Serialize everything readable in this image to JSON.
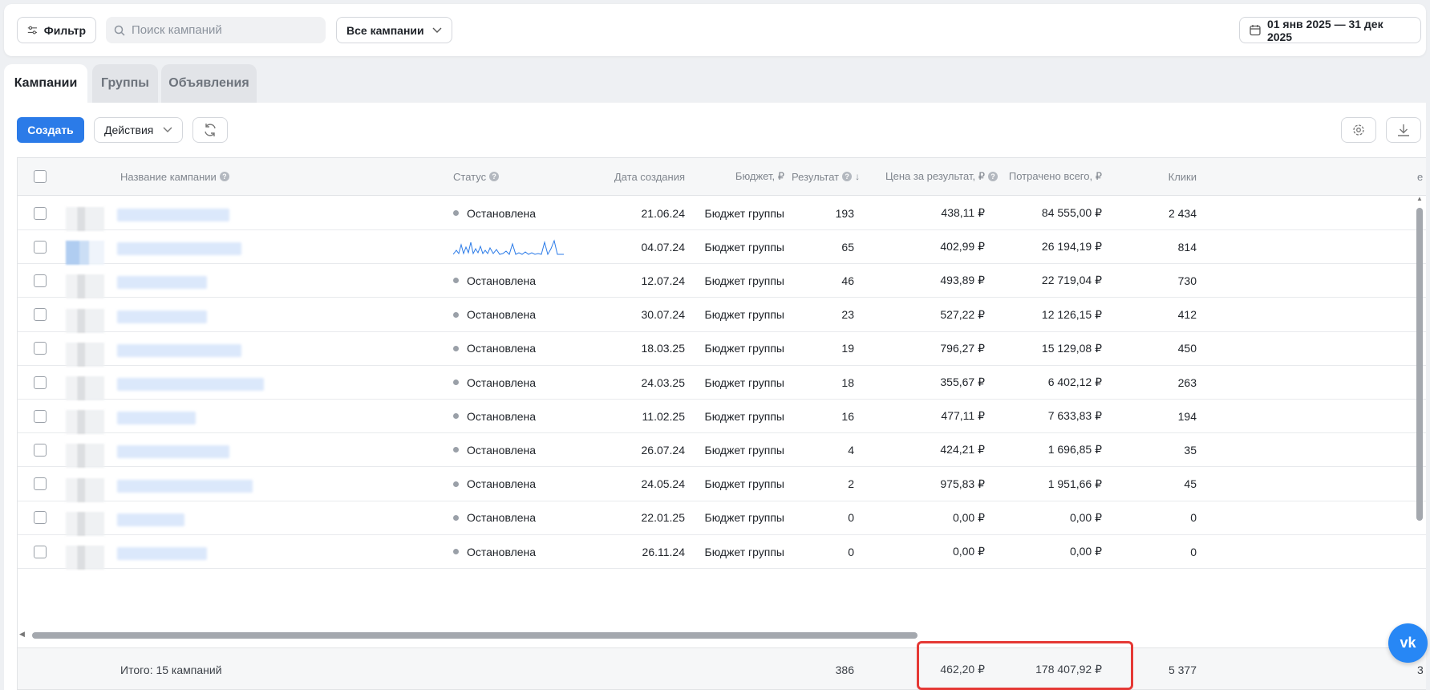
{
  "topbar": {
    "filter_label": "Фильтр",
    "search_placeholder": "Поиск кампаний",
    "campaigns_select": "Все кампании",
    "date_range": "01 янв 2025 — 31 дек 2025"
  },
  "tabs": [
    {
      "label": "Кампании",
      "active": true
    },
    {
      "label": "Группы",
      "active": false
    },
    {
      "label": "Объявления",
      "active": false
    }
  ],
  "toolbar": {
    "create_label": "Создать",
    "actions_label": "Действия"
  },
  "table": {
    "headers": {
      "name": "Название кампании",
      "status": "Статус",
      "created": "Дата создания",
      "budget": "Бюджет, ₽",
      "result": "Результат",
      "cpr": "Цена за результат, ₽",
      "spent": "Потрачено всего, ₽",
      "clicks": "Клики",
      "extra": "е"
    },
    "rows": [
      {
        "status": "Остановлена",
        "created": "21.06.24",
        "budget": "Бюджет группы",
        "result": "193",
        "cpr": "438,11 ₽",
        "spent": "84 555,00 ₽",
        "clicks": "2 434"
      },
      {
        "status": "",
        "created": "04.07.24",
        "budget": "Бюджет группы",
        "result": "65",
        "cpr": "402,99 ₽",
        "spent": "26 194,19 ₽",
        "clicks": "814"
      },
      {
        "status": "Остановлена",
        "created": "12.07.24",
        "budget": "Бюджет группы",
        "result": "46",
        "cpr": "493,89 ₽",
        "spent": "22 719,04 ₽",
        "clicks": "730"
      },
      {
        "status": "Остановлена",
        "created": "30.07.24",
        "budget": "Бюджет группы",
        "result": "23",
        "cpr": "527,22 ₽",
        "spent": "12 126,15 ₽",
        "clicks": "412"
      },
      {
        "status": "Остановлена",
        "created": "18.03.25",
        "budget": "Бюджет группы",
        "result": "19",
        "cpr": "796,27 ₽",
        "spent": "15 129,08 ₽",
        "clicks": "450"
      },
      {
        "status": "Остановлена",
        "created": "24.03.25",
        "budget": "Бюджет группы",
        "result": "18",
        "cpr": "355,67 ₽",
        "spent": "6 402,12 ₽",
        "clicks": "263"
      },
      {
        "status": "Остановлена",
        "created": "11.02.25",
        "budget": "Бюджет группы",
        "result": "16",
        "cpr": "477,11 ₽",
        "spent": "7 633,83 ₽",
        "clicks": "194"
      },
      {
        "status": "Остановлена",
        "created": "26.07.24",
        "budget": "Бюджет группы",
        "result": "4",
        "cpr": "424,21 ₽",
        "spent": "1 696,85 ₽",
        "clicks": "35"
      },
      {
        "status": "Остановлена",
        "created": "24.05.24",
        "budget": "Бюджет группы",
        "result": "2",
        "cpr": "975,83 ₽",
        "spent": "1 951,66 ₽",
        "clicks": "45"
      },
      {
        "status": "Остановлена",
        "created": "22.01.25",
        "budget": "Бюджет группы",
        "result": "0",
        "cpr": "0,00 ₽",
        "spent": "0,00 ₽",
        "clicks": "0"
      },
      {
        "status": "Остановлена",
        "created": "26.11.24",
        "budget": "Бюджет группы",
        "result": "0",
        "cpr": "0,00 ₽",
        "spent": "0,00 ₽",
        "clicks": "0"
      }
    ],
    "totals": {
      "label": "Итого: 15 кампаний",
      "result": "386",
      "cpr": "462,20 ₽",
      "spent": "178 407,92 ₽",
      "clicks": "5 377",
      "extra": "3"
    }
  },
  "colors": {
    "primary": "#2b7be8",
    "highlight_box": "#e53935",
    "vk_button": "#2787f5"
  }
}
